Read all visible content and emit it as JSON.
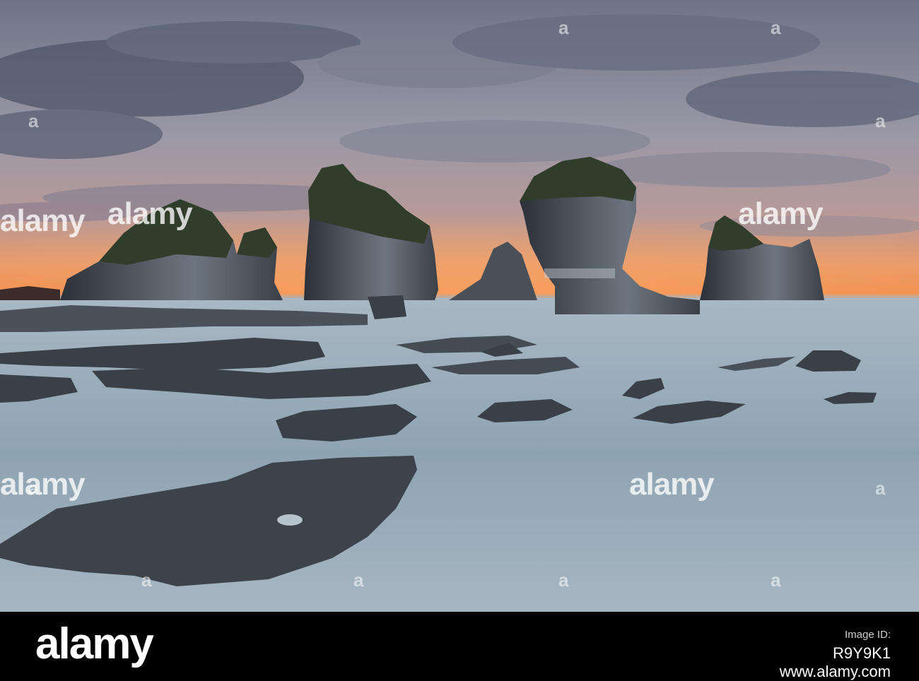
{
  "watermark": {
    "text": "alamy",
    "small_mark": "a"
  },
  "footer": {
    "logo": "alamy",
    "image_id_label": "Image ID:",
    "image_id": "R9Y9K1",
    "url": "www.alamy.com"
  },
  "colors": {
    "sky_top": "#5c6478",
    "sky_glow": "#f08a4a",
    "sea": "#9aaebc",
    "rock": "#3a4048",
    "foliage": "#2f3d2a"
  }
}
